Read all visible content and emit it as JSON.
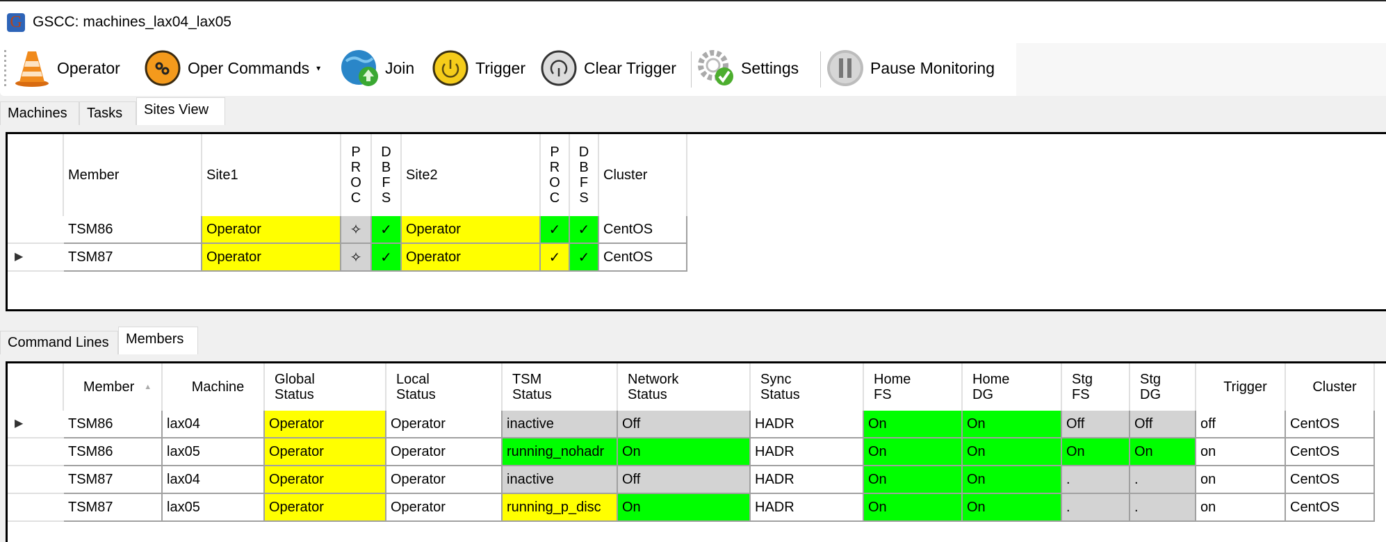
{
  "window": {
    "title": "GSCC: machines_lax04_lax05",
    "app_icon_letter": "G"
  },
  "toolbar": {
    "buttons": [
      {
        "label": "Operator",
        "icon": "traffic-cone-icon"
      },
      {
        "label": "Oper Commands",
        "icon": "gears-icon",
        "dropdown": "▾"
      },
      {
        "label": "Join",
        "icon": "globe-upload-icon"
      },
      {
        "label": "Trigger",
        "icon": "power-yellow-icon"
      },
      {
        "label": "Clear Trigger",
        "icon": "power-gray-icon"
      },
      {
        "label": "Settings",
        "icon": "gear-check-icon"
      },
      {
        "label": "Pause Monitoring",
        "icon": "pause-icon"
      }
    ]
  },
  "top_tabs": [
    {
      "label": "Machines",
      "active": false
    },
    {
      "label": "Tasks",
      "active": false
    },
    {
      "label": "Sites View",
      "active": true
    }
  ],
  "sites_view": {
    "columns": [
      "Member",
      "Site1",
      "PROC",
      "DBFS",
      "Site2",
      "PROC",
      "DBFS",
      "Cluster"
    ],
    "rows": [
      {
        "selected": false,
        "member": "TSM86",
        "site1": "Operator",
        "proc1": "✧",
        "dbfs1": "✓",
        "site2": "Operator",
        "proc2": "✓",
        "dbfs2": "✓",
        "cluster": "CentOS"
      },
      {
        "selected": true,
        "member": "TSM87",
        "site1": "Operator",
        "proc1": "✧",
        "dbfs1": "✓",
        "site2": "Operator",
        "proc2": "✓",
        "dbfs2": "✓",
        "cluster": "CentOS"
      }
    ],
    "row_indicator": "▶"
  },
  "bottom_tabs": [
    {
      "label": "Command Lines",
      "active": false
    },
    {
      "label": "Members",
      "active": true
    }
  ],
  "members": {
    "columns": [
      "Member",
      "Machine",
      "Global\nStatus",
      "Local\nStatus",
      "TSM\nStatus",
      "Network\nStatus",
      "Sync\nStatus",
      "Home\nFS",
      "Home\nDG",
      "Stg\nFS",
      "Stg\nDG",
      "Trigger",
      "Cluster"
    ],
    "column_labels": [
      [
        "Member"
      ],
      [
        "Machine"
      ],
      [
        "Global",
        "Status"
      ],
      [
        "Local",
        "Status"
      ],
      [
        "TSM",
        "Status"
      ],
      [
        "Network",
        "Status"
      ],
      [
        "Sync",
        "Status"
      ],
      [
        "Home",
        "FS"
      ],
      [
        "Home",
        "DG"
      ],
      [
        "Stg",
        "FS"
      ],
      [
        "Stg",
        "DG"
      ],
      [
        "Trigger"
      ],
      [
        "Cluster"
      ]
    ],
    "sort_indicator": "▲",
    "rows": [
      {
        "selected": true,
        "cells": [
          "TSM86",
          "lax04",
          "Operator",
          "Operator",
          "inactive",
          "Off",
          "HADR",
          "On",
          "On",
          "Off",
          "Off",
          "off",
          "CentOS"
        ]
      },
      {
        "selected": false,
        "cells": [
          "TSM86",
          "lax05",
          "Operator",
          "Operator",
          "running_nohadr",
          "On",
          "HADR",
          "On",
          "On",
          "On",
          "On",
          "on",
          "CentOS"
        ]
      },
      {
        "selected": false,
        "cells": [
          "TSM87",
          "lax04",
          "Operator",
          "Operator",
          "inactive",
          "Off",
          "HADR",
          "On",
          "On",
          ".",
          ".",
          "on",
          "CentOS"
        ]
      },
      {
        "selected": false,
        "cells": [
          "TSM87",
          "lax05",
          "Operator",
          "Operator",
          "running_p_disc",
          "On",
          "HADR",
          "On",
          "On",
          ".",
          ".",
          "on",
          "CentOS"
        ]
      }
    ],
    "row_indicator": "▶"
  },
  "colors": {
    "yellow": "#ffff00",
    "green": "#00ff00",
    "gray": "#d3d3d3"
  }
}
